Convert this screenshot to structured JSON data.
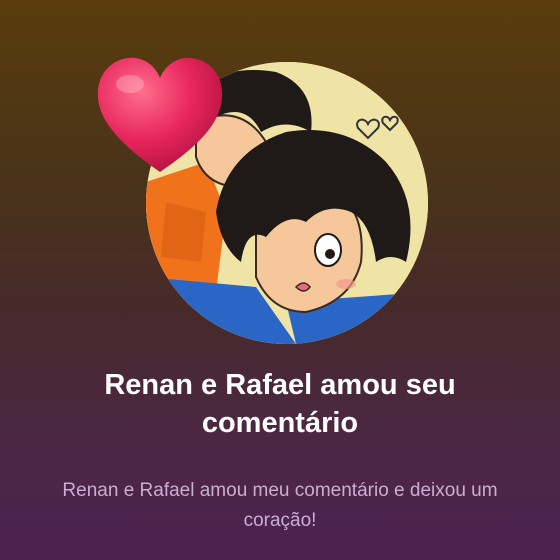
{
  "notification": {
    "title": "Renan e Rafael amou seu comentário",
    "message": "Renan e Rafael amou meu comentário e deixou um coração!",
    "reaction_icon": "heart-icon",
    "avatar_icon": "profile-avatar-illustration"
  },
  "colors": {
    "background_top": "#5a3c0c",
    "background_bottom": "#4d2150",
    "title": "#ffffff",
    "message": "#c9aed2",
    "heart": "#e8265e",
    "avatar_bg": "#efe4a6"
  }
}
